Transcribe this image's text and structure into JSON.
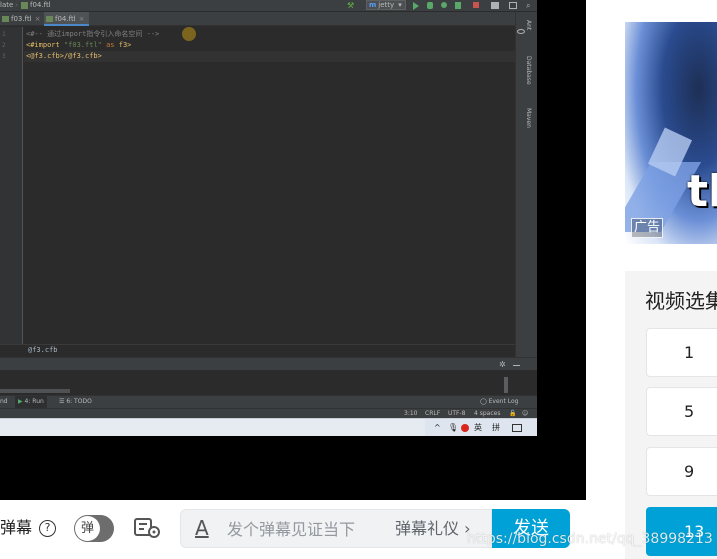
{
  "ide": {
    "title_bar": {
      "breadcrumb_prev": "late",
      "breadcrumb_file": "f04.ftl",
      "run_config": "jetty"
    },
    "tabs": [
      {
        "label": "f03.ftl",
        "close": "×",
        "active": false
      },
      {
        "label": "f04.ftl",
        "close": "×",
        "active": true
      }
    ],
    "code_lines": [
      {
        "num": "1",
        "text": "<#-- 通过import指令引入命名空间 -->"
      },
      {
        "num": "2",
        "prefix": "<#import ",
        "str": "\"f03.ftl\"",
        "kw": " as ",
        "suffix": "f3>"
      },
      {
        "num": "3",
        "text": "<@f3.cfb>/@f3.cfb>"
      }
    ],
    "right_panels": [
      "Ant",
      "Database",
      "Maven"
    ],
    "breadcrumb_bottom": "@f3.cfb",
    "bottom_tabs": {
      "partial": "nd",
      "run": "4: Run",
      "todo": "6: TODO"
    },
    "event_log": "Event Log",
    "status": {
      "position": "3:10",
      "line_sep": "CRLF",
      "encoding": "UTF-8",
      "indent": "4 spaces"
    },
    "taskbar": {
      "ime_lang": "英",
      "ime_mode": "拼"
    }
  },
  "ad": {
    "word": "th",
    "badge": "广告"
  },
  "playlist": {
    "title": "视频选集",
    "episodes": [
      "1",
      "5",
      "9",
      "13"
    ],
    "active_index": 3
  },
  "danmaku": {
    "label": "弹幕",
    "toggle_text": "弹",
    "placeholder": "发个弹幕见证当下",
    "etiquette": "弹幕礼仪 ›",
    "send": "发送"
  },
  "watermark": "https://blog.csdn.net/qq_38998213",
  "colors": {
    "accent": "#00a1d6",
    "ide_bg": "#2b2b2b",
    "ide_panel": "#3c3f41"
  }
}
